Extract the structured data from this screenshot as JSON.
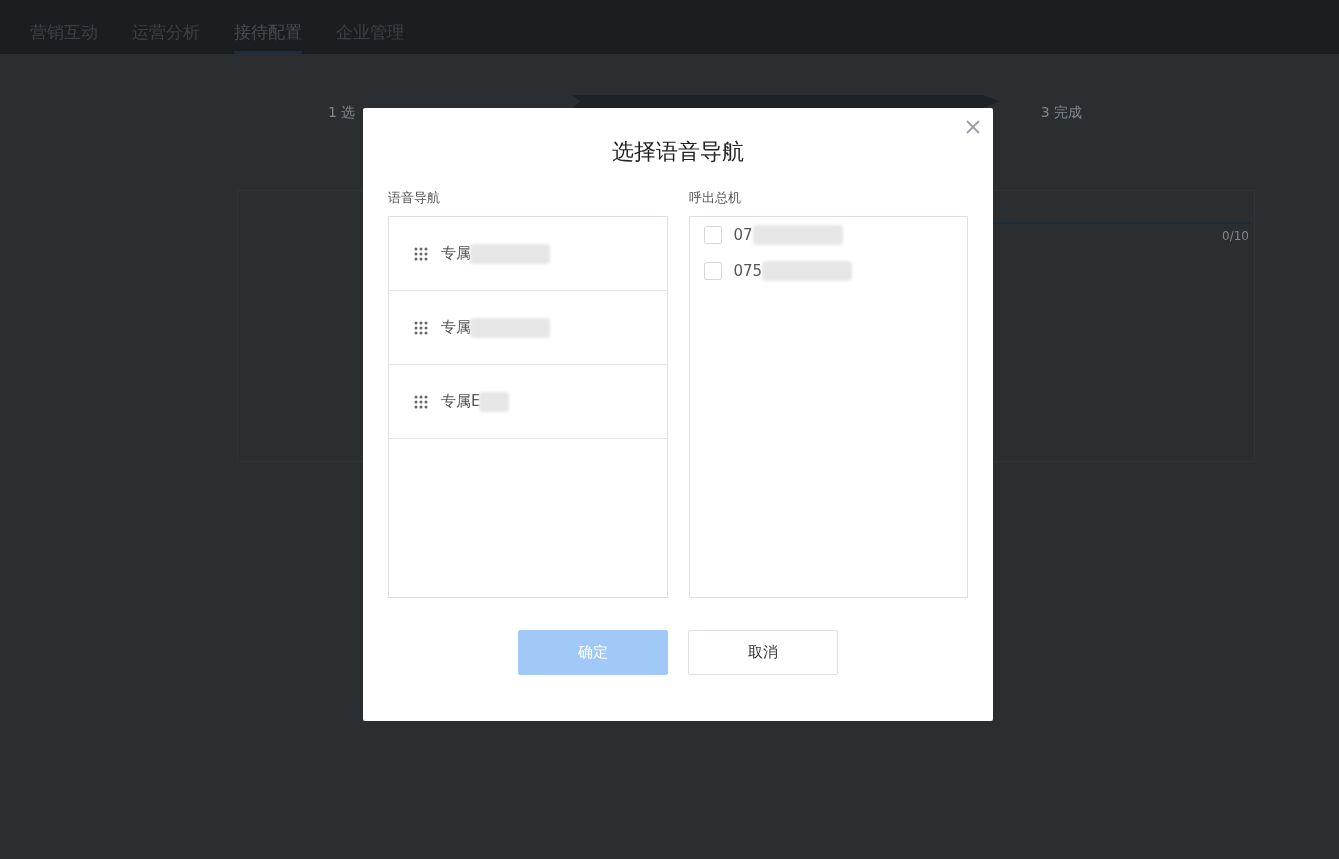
{
  "nav": {
    "tabs": [
      {
        "label": "营销互动",
        "selected": false
      },
      {
        "label": "运营分析",
        "selected": false
      },
      {
        "label": "接待配置",
        "selected": true
      },
      {
        "label": "企业管理",
        "selected": false
      }
    ]
  },
  "steps": [
    {
      "label": "1 选",
      "selected": false
    },
    {
      "label": "3 完成",
      "selected": false
    }
  ],
  "background": {
    "counter": "0/10"
  },
  "dialog": {
    "title": "选择语音导航",
    "navigation": {
      "label": "语音导航",
      "items": [
        {
          "text": "专属"
        },
        {
          "text": "专属"
        },
        {
          "text": "专属E"
        }
      ]
    },
    "trunk": {
      "label": "呼出总机",
      "items": [
        {
          "text": "07",
          "checked": false
        },
        {
          "text": "075",
          "checked": false
        }
      ]
    },
    "buttons": [
      {
        "label": "确定",
        "kind": "primary",
        "disabled": true
      },
      {
        "label": "取消",
        "kind": "default",
        "disabled": false
      }
    ]
  }
}
